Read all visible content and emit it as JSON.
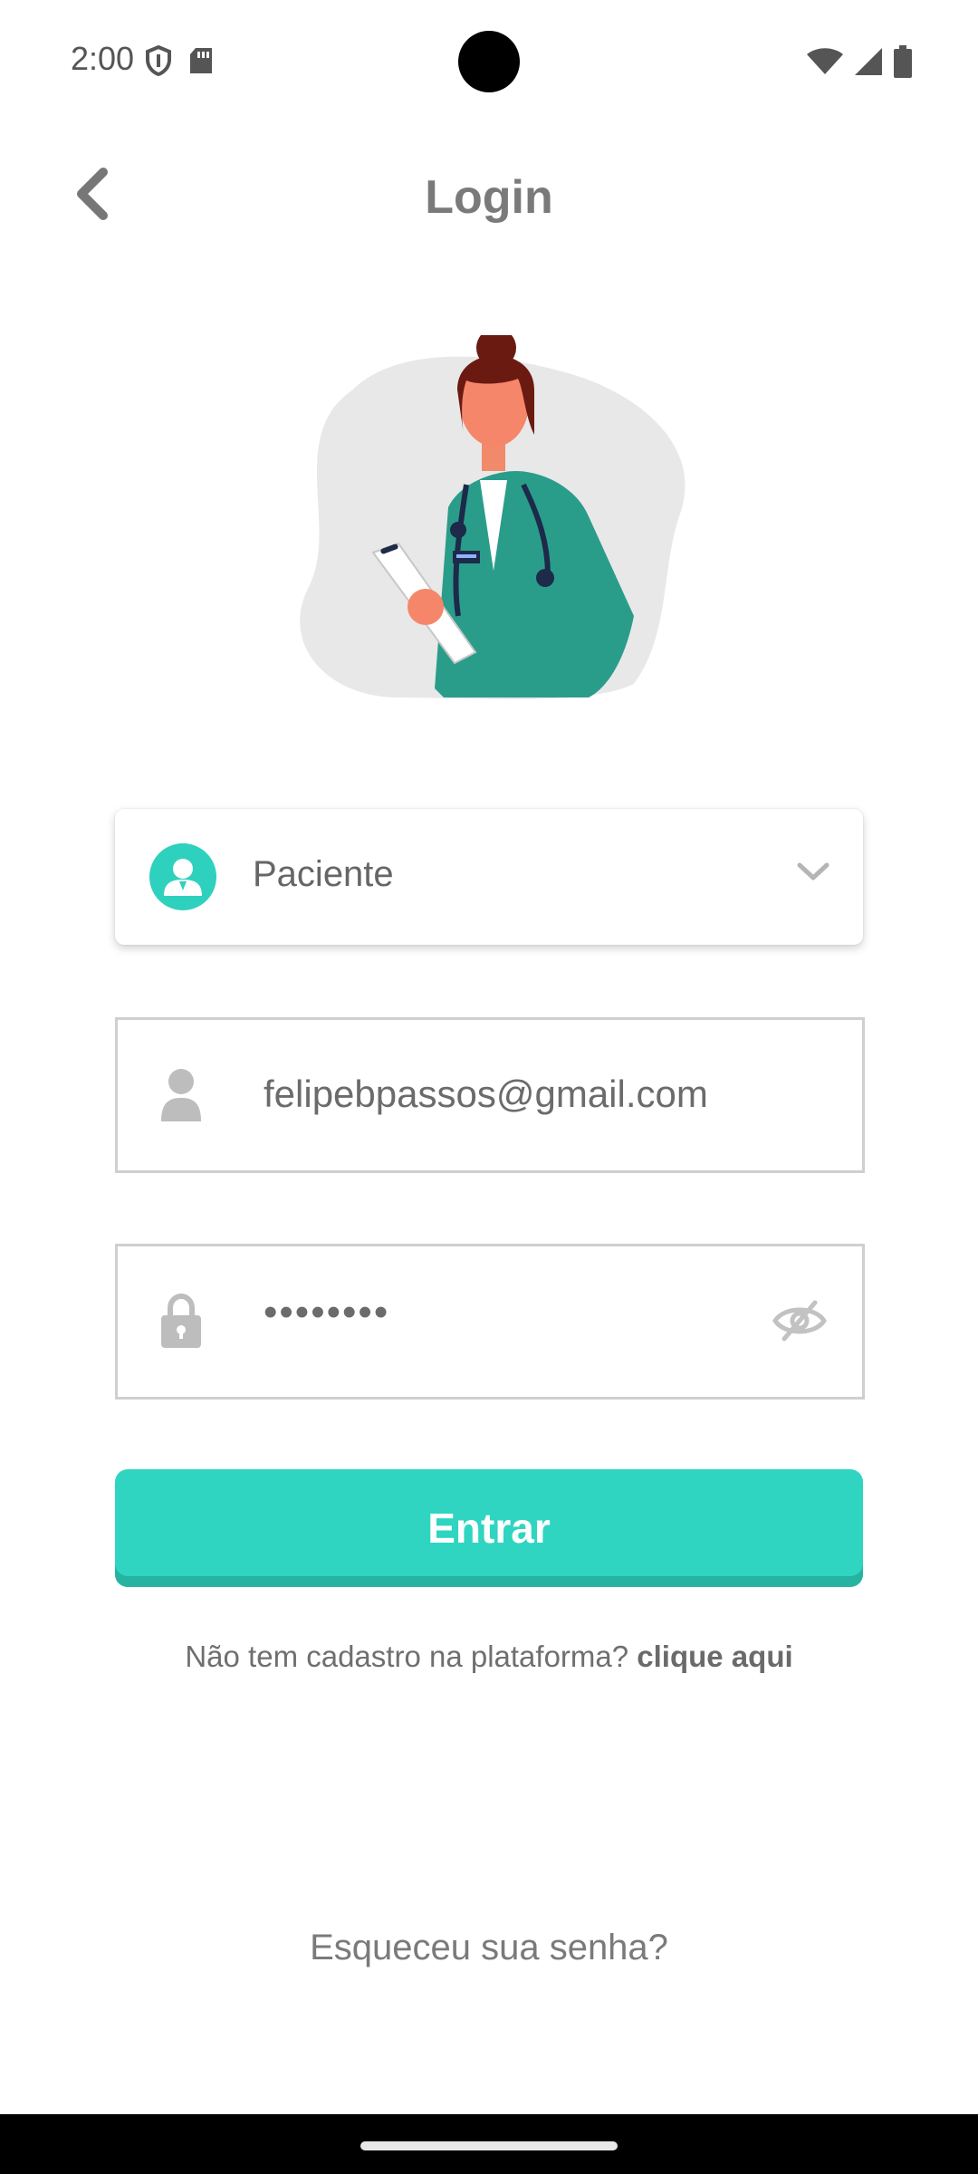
{
  "status_bar": {
    "time": "2:00",
    "icons": [
      "shield-icon",
      "sd-card-icon",
      "wifi-icon",
      "signal-icon",
      "battery-icon"
    ]
  },
  "header": {
    "title": "Login",
    "back_icon": "chevron-left-icon"
  },
  "role_select": {
    "selected": "Paciente",
    "avatar_icon": "user-icon",
    "chevron_icon": "chevron-down-icon"
  },
  "email_field": {
    "value": "felipebpassos@gmail.com",
    "icon": "person-icon"
  },
  "password_field": {
    "value": "••••••••",
    "icon": "lock-icon",
    "toggle_icon": "eye-off-icon"
  },
  "submit": {
    "label": "Entrar"
  },
  "signup": {
    "prompt": "Não tem cadastro na plataforma?",
    "link": "clique aqui"
  },
  "forgot_password": {
    "label": "Esqueceu sua senha?"
  },
  "colors": {
    "accent": "#2fd5c0",
    "accent_dark": "#27b3a2",
    "text_gray": "#7a7a7a",
    "field_border": "#cfcfcf"
  }
}
